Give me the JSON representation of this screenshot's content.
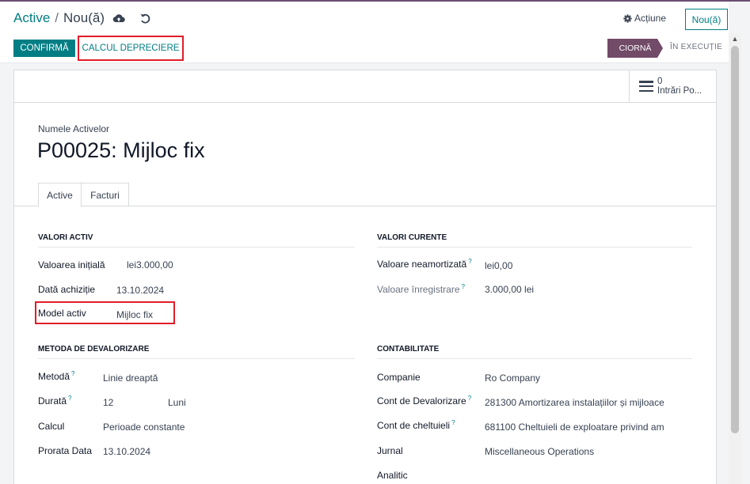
{
  "breadcrumb": {
    "parent": "Active",
    "separator": "/",
    "current": "Nou(ă)"
  },
  "header": {
    "actiune_label": "Acțiune",
    "new_label": "Nou(ă)"
  },
  "toolbar": {
    "confirm_label": "CONFIRMĂ",
    "calc_label": "CALCUL DEPRECIERE"
  },
  "status": {
    "stages": [
      "CIORNĂ",
      "ÎN EXECUȚIE"
    ]
  },
  "smart_button": {
    "count": "0",
    "label": "Intrări Po..."
  },
  "form": {
    "name_label": "Numele Activelor",
    "name_value": "P00025: Mijloc fix",
    "tabs": [
      "Active",
      "Facturi"
    ]
  },
  "valori_activ": {
    "title": "VALORI ACTIV",
    "rows": [
      {
        "label": "Valoarea inițială",
        "value": "lei3.000,00"
      },
      {
        "label": "Dată achiziție",
        "value": "13.10.2024"
      },
      {
        "label": "Model activ",
        "value": "Mijloc fix"
      }
    ]
  },
  "valori_curente": {
    "title": "VALORI CURENTE",
    "rows": [
      {
        "label": "Valoare neamortizată",
        "help": "?",
        "value": "lei0,00"
      },
      {
        "label": "Valoare înregistrare",
        "help": "?",
        "value": "3.000,00 lei"
      }
    ]
  },
  "metoda": {
    "title": "METODA DE DEVALORIZARE",
    "rows": [
      {
        "label": "Metodă",
        "help": "?",
        "value": "Linie dreaptă"
      },
      {
        "label": "Durată",
        "help": "?",
        "value": "12",
        "unit": "Luni"
      },
      {
        "label": "Calcul",
        "value": "Perioade constante"
      },
      {
        "label": "Prorata Data",
        "value": "13.10.2024"
      }
    ]
  },
  "contabilitate": {
    "title": "CONTABILITATE",
    "rows": [
      {
        "label": "Companie",
        "value": "Ro Company"
      },
      {
        "label": "Cont de Devalorizare",
        "help": "?",
        "value": "281300 Amortizarea instalațiilor și mijloace"
      },
      {
        "label": "Cont de cheltuieli",
        "help": "?",
        "value": "681100 Cheltuieli de exploatare privind am"
      },
      {
        "label": "Jurnal",
        "value": "Miscellaneous Operations"
      },
      {
        "label": "Analitic",
        "value": ""
      }
    ]
  }
}
